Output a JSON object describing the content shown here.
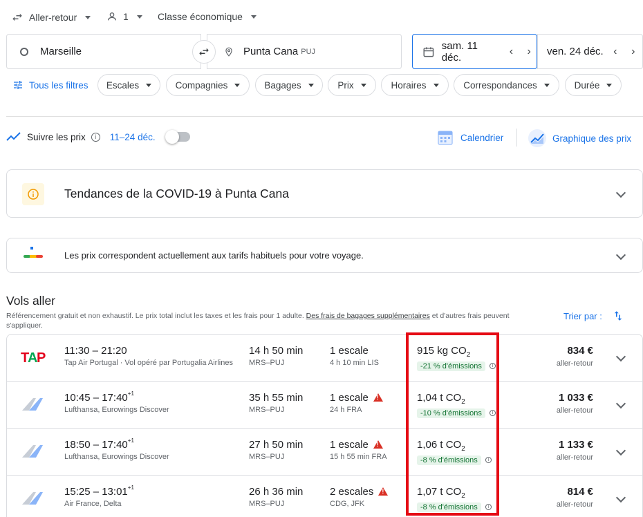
{
  "topbar": {
    "trip_type": "Aller-retour",
    "passengers": "1",
    "cabin_class": "Classe économique"
  },
  "search": {
    "origin": "Marseille",
    "destination": "Punta Cana",
    "destination_code": "PUJ",
    "depart_date": "sam. 11 déc.",
    "return_date": "ven. 24 déc."
  },
  "filters": {
    "all_filters": "Tous les filtres",
    "chips": [
      "Escales",
      "Compagnies",
      "Bagages",
      "Prix",
      "Horaires",
      "Correspondances",
      "Durée"
    ]
  },
  "tracking": {
    "label": "Suivre les prix",
    "dates": "11–24 déc.",
    "calendar": "Calendrier",
    "price_graph": "Graphique des prix"
  },
  "covid": {
    "title": "Tendances de la COVID-19 à Punta Cana"
  },
  "price_insight": {
    "text": "Les prix correspondent actuellement aux tarifs habituels pour votre voyage."
  },
  "results": {
    "heading": "Vols aller",
    "disclaimer_pre": "Référencement gratuit et non exhaustif. Le prix total inclut les taxes et les frais pour 1 adulte. ",
    "disclaimer_link": "Des frais de bagages supplémentaires",
    "disclaimer_post": " et d'autres frais peuvent s'appliquer.",
    "sort_label": "Trier par :"
  },
  "flights": [
    {
      "time": "11:30 – 21:20",
      "time_sup": "",
      "airline": "Tap Air Portugal · Vol opéré par Portugalia Airlines",
      "duration": "14 h 50 min",
      "route": "MRS–PUJ",
      "stops": "1 escale",
      "stop_detail": "4 h 10 min LIS",
      "warning": false,
      "co2": "915 kg CO",
      "co2_sub": "2",
      "emissions": "-21 % d'émissions",
      "price": "834 €",
      "price_sub": "aller-retour",
      "logo": "tap-logo"
    },
    {
      "time": "10:45 – 17:40",
      "time_sup": "+1",
      "airline": "Lufthansa, Eurowings Discover",
      "duration": "35 h 55 min",
      "route": "MRS–PUJ",
      "stops": "1 escale",
      "stop_detail": "24 h FRA",
      "warning": true,
      "co2": "1,04 t CO",
      "co2_sub": "2",
      "emissions": "-10 % d'émissions",
      "price": "1 033 €",
      "price_sub": "aller-retour",
      "logo": "multi-airline-logo"
    },
    {
      "time": "18:50 – 17:40",
      "time_sup": "+1",
      "airline": "Lufthansa, Eurowings Discover",
      "duration": "27 h 50 min",
      "route": "MRS–PUJ",
      "stops": "1 escale",
      "stop_detail": "15 h 55 min FRA",
      "warning": true,
      "co2": "1,06 t CO",
      "co2_sub": "2",
      "emissions": "-8 % d'émissions",
      "price": "1 133 €",
      "price_sub": "aller-retour",
      "logo": "multi-airline-logo"
    },
    {
      "time": "15:25 – 13:01",
      "time_sup": "+1",
      "airline": "Air France, Delta",
      "duration": "26 h 36 min",
      "route": "MRS–PUJ",
      "stops": "2 escales",
      "stop_detail": "CDG, JFK",
      "warning": true,
      "co2": "1,07 t CO",
      "co2_sub": "2",
      "emissions": "-8 % d'émissions",
      "price": "814 €",
      "price_sub": "aller-retour",
      "logo": "multi-airline-logo"
    }
  ],
  "colors": {
    "accent": "#1a73e8",
    "highlight": "#e50914",
    "emission_bg": "#e6f4ea",
    "emission_text": "#137333",
    "warning": "#d93025"
  }
}
